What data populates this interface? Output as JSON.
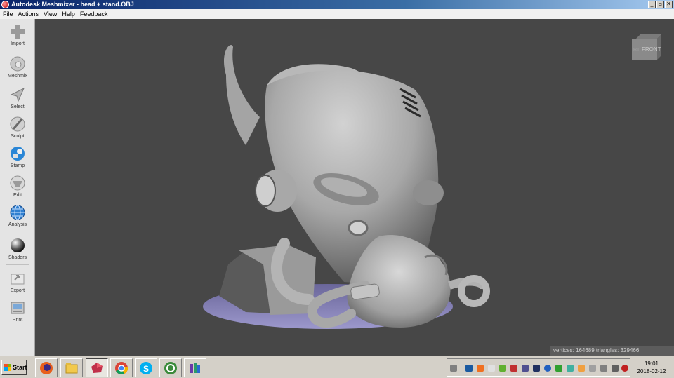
{
  "window": {
    "title": "Autodesk Meshmixer - head + stand.OBJ",
    "controls": [
      "_",
      "▫",
      "✕"
    ]
  },
  "menu": [
    "File",
    "Actions",
    "View",
    "Help",
    "Feedback"
  ],
  "tools": [
    {
      "label": "Import",
      "icon": "plus-icon"
    },
    {
      "label": "Meshmix",
      "icon": "meshmix-icon"
    },
    {
      "label": "Select",
      "icon": "arrow-icon"
    },
    {
      "label": "Sculpt",
      "icon": "brush-icon"
    },
    {
      "label": "Stamp",
      "icon": "stamp-icon"
    },
    {
      "label": "Edit",
      "icon": "edit-icon"
    },
    {
      "label": "Analysis",
      "icon": "globe-icon"
    },
    {
      "label": "Shaders",
      "icon": "sphere-icon"
    },
    {
      "label": "Export",
      "icon": "export-icon"
    },
    {
      "label": "Print",
      "icon": "printer-icon"
    }
  ],
  "viewcube": {
    "face_label": "FRONT",
    "side_label": "RT"
  },
  "stats": "vertices: 164689 triangles: 329466",
  "taskbar": {
    "start_label": "Start",
    "apps": [
      "firefox-icon",
      "file-explorer-icon",
      "meshmixer-icon",
      "chrome-icon",
      "skype-icon",
      "green-ring-icon",
      "app-bars-icon"
    ],
    "clock_time": "19:01",
    "clock_date": "2018-02-12"
  },
  "colors": {
    "viewport_bg": "#474747",
    "model": "#b4b4b4",
    "stand_base": "#8682b8",
    "titlebar": "#0a246a"
  }
}
